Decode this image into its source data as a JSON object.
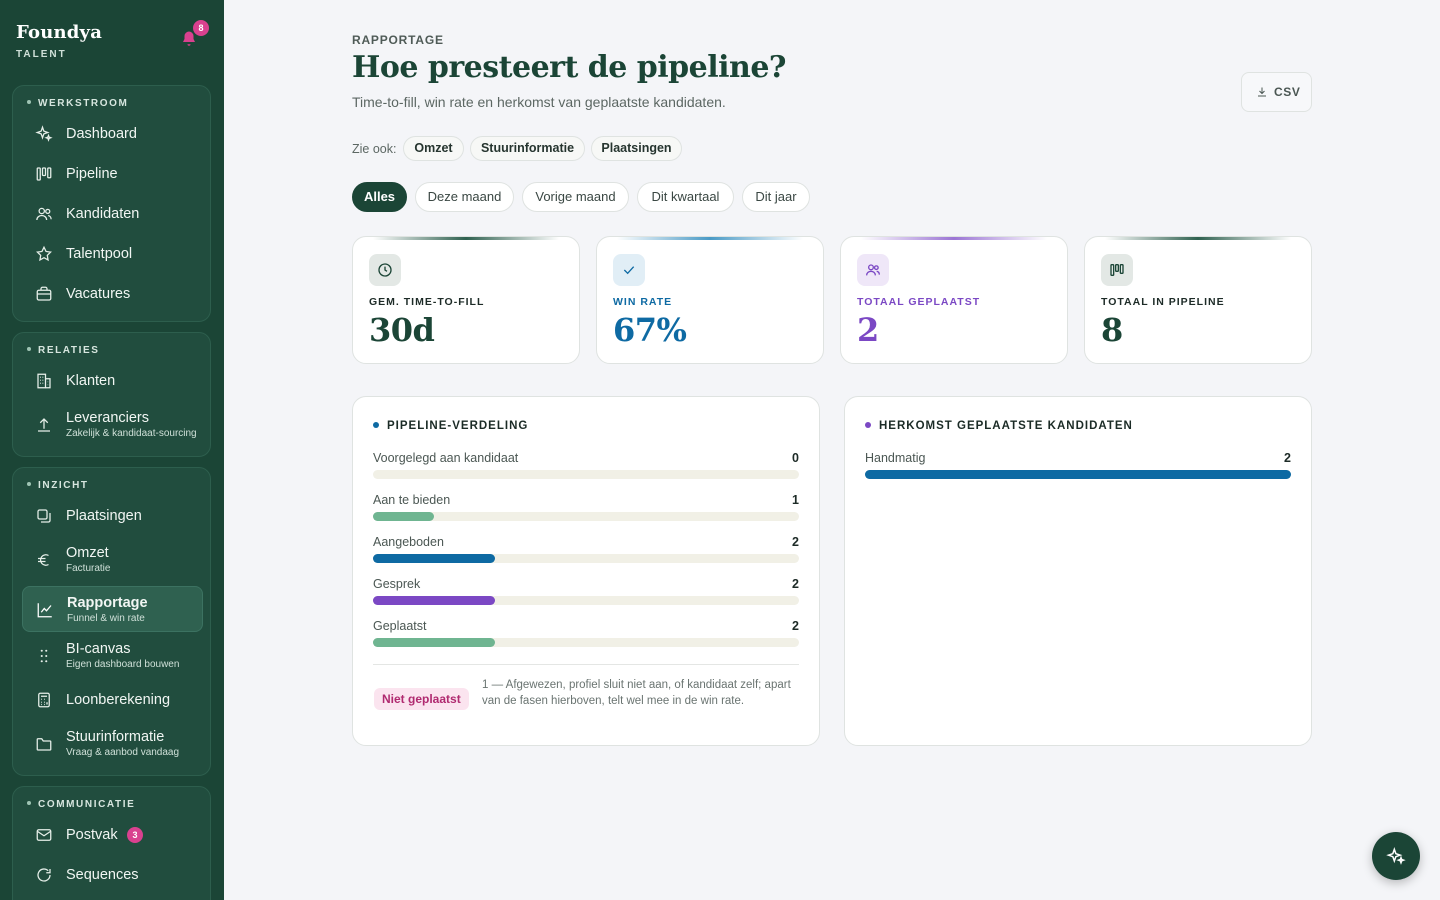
{
  "brand": {
    "name": "Foundya",
    "sub": "TALENT",
    "notifications": "8"
  },
  "sidebar": {
    "groups": [
      {
        "title": "WERKSTROOM",
        "items": [
          {
            "label": "Dashboard",
            "icon": "sparkle-icon"
          },
          {
            "label": "Pipeline",
            "icon": "kanban-icon"
          },
          {
            "label": "Kandidaten",
            "icon": "users-icon"
          },
          {
            "label": "Talentpool",
            "icon": "star-icon"
          },
          {
            "label": "Vacatures",
            "icon": "briefcase-icon"
          }
        ]
      },
      {
        "title": "RELATIES",
        "items": [
          {
            "label": "Klanten",
            "icon": "building-icon"
          },
          {
            "label": "Leveranciers",
            "sub": "Zakelijk & kandidaat-sourcing",
            "icon": "upload-icon"
          }
        ]
      },
      {
        "title": "INZICHT",
        "items": [
          {
            "label": "Plaatsingen",
            "icon": "copy-icon"
          },
          {
            "label": "Omzet",
            "sub": "Facturatie",
            "icon": "euro-icon"
          },
          {
            "label": "Rapportage",
            "sub": "Funnel & win rate",
            "icon": "line-chart-icon",
            "active": true
          },
          {
            "label": "BI-canvas",
            "sub": "Eigen dashboard bouwen",
            "icon": "grid-dots-icon"
          },
          {
            "label": "Loonberekening",
            "icon": "calculator-icon"
          },
          {
            "label": "Stuurinformatie",
            "sub": "Vraag & aanbod vandaag",
            "icon": "folder-icon"
          }
        ]
      },
      {
        "title": "COMMUNICATIE",
        "items": [
          {
            "label": "Postvak",
            "badge": "3",
            "icon": "mail-icon"
          },
          {
            "label": "Sequences",
            "icon": "refresh-icon"
          }
        ]
      }
    ]
  },
  "header": {
    "eyebrow": "RAPPORTAGE",
    "title": "Hoe presteert de pipeline?",
    "subtitle": "Time-to-fill, win rate en herkomst van geplaatste kandidaten.",
    "csv_label": "CSV"
  },
  "see_also": {
    "label": "Zie ook:",
    "chips": [
      "Omzet",
      "Stuurinformatie",
      "Plaatsingen"
    ]
  },
  "periods": {
    "options": [
      "Alles",
      "Deze maand",
      "Vorige maand",
      "Dit kwartaal",
      "Dit jaar"
    ],
    "selected": "Alles"
  },
  "kpis": [
    {
      "label": "GEM. TIME-TO-FILL",
      "value": "30d",
      "icon": "clock-icon",
      "color": "#1b4536"
    },
    {
      "label": "WIN RATE",
      "value": "67%",
      "icon": "check-icon",
      "color": "#0e6aa3"
    },
    {
      "label": "TOTAAL GEPLAATST",
      "value": "2",
      "icon": "users-icon",
      "color": "#7b48c4"
    },
    {
      "label": "TOTAAL IN PIPELINE",
      "value": "8",
      "icon": "kanban-icon",
      "color": "#1b4536"
    }
  ],
  "pipeline_panel": {
    "title": "PIPELINE-VERDELING",
    "rows": [
      {
        "label": "Voorgelegd aan kandidaat",
        "value": 0,
        "color": "#6fb591"
      },
      {
        "label": "Aan te bieden",
        "value": 1,
        "color": "#6fb591"
      },
      {
        "label": "Aangeboden",
        "value": 2,
        "color": "#0e6aa3"
      },
      {
        "label": "Gesprek",
        "value": 2,
        "color": "#7b48c4"
      },
      {
        "label": "Geplaatst",
        "value": 2,
        "color": "#6fb591"
      }
    ],
    "max": 7,
    "not_placed_label": "Niet geplaatst",
    "not_placed_text": "1 — Afgewezen, profiel sluit niet aan, of kandidaat zelf; apart van de fasen hierboven, telt wel mee in de win rate."
  },
  "origin_panel": {
    "title": "HERKOMST GEPLAATSTE KANDIDATEN",
    "rows": [
      {
        "label": "Handmatig",
        "value": 2,
        "color": "#0e6aa3"
      }
    ],
    "max": 2
  }
}
